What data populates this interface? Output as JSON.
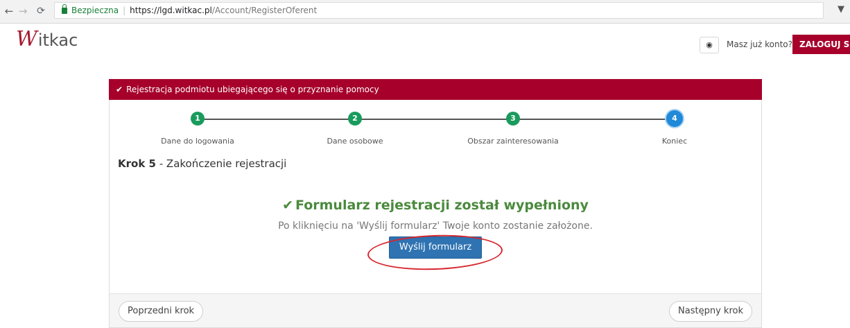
{
  "browser": {
    "secure_label": "Bezpieczna",
    "url_host": "https://lgd.witkac.pl",
    "url_path": "/Account/RegisterOferent"
  },
  "header": {
    "logo_initial": "W",
    "logo_rest": "itkac",
    "have_account": "Masz już konto?",
    "login_button": "ZALOGUJ SIĘ"
  },
  "panel": {
    "title": "Rejestracja podmiotu ubiegającego się o przyznanie pomocy",
    "steps": [
      {
        "number": "1",
        "label": "Dane do logowania"
      },
      {
        "number": "2",
        "label": "Dane osobowe"
      },
      {
        "number": "3",
        "label": "Obszar zainteresowania"
      },
      {
        "number": "4",
        "label": "Koniec"
      }
    ],
    "step_prefix": "Krok 5",
    "step_title": " - Zakończenie rejestracji",
    "success_title": "Formularz rejestracji został wypełniony",
    "success_sub": "Po kliknięciu na 'Wyślij formularz' Twoje konto zostanie założone.",
    "send_button": "Wyślij formularz",
    "prev_button": "Poprzedni krok",
    "next_button": "Następny krok"
  },
  "colors": {
    "brand_red": "#a6002b",
    "step_done": "#1a9b5e",
    "step_active": "#2089d8",
    "success_green": "#4a8a3d",
    "primary_button": "#2f73b2"
  }
}
